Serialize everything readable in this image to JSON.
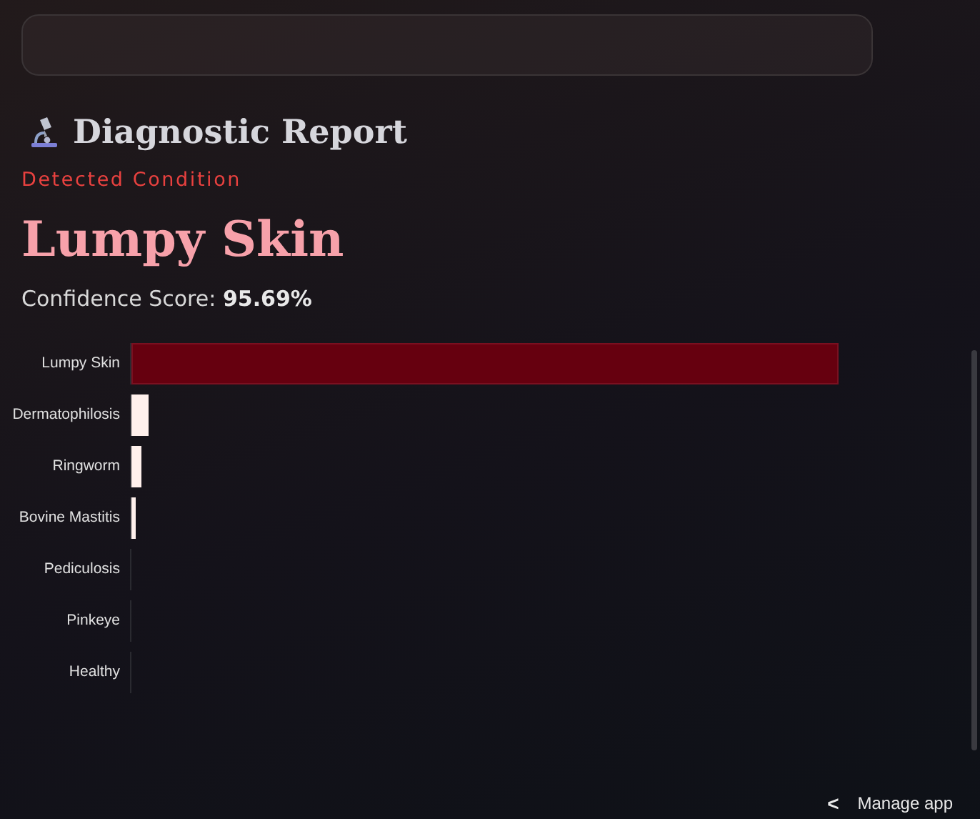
{
  "report": {
    "title": "Diagnostic Report",
    "label": "Detected Condition",
    "condition": "Lumpy Skin",
    "confidence_label": "Confidence Score:",
    "confidence_value": "95.69%"
  },
  "bars": [
    {
      "label": "Lumpy Skin",
      "level": 0.957,
      "selected": true
    },
    {
      "label": "Dermatophilosis",
      "level": 0.024,
      "selected": false
    },
    {
      "label": "Ringworm",
      "level": 0.014,
      "selected": false
    },
    {
      "label": "Bovine Mastitis",
      "level": 0.005,
      "selected": false
    },
    {
      "label": "Pediculosis",
      "level": 0,
      "selected": false
    },
    {
      "label": "Pinkeye",
      "level": 0,
      "selected": false
    },
    {
      "label": "Healthy",
      "level": 0,
      "selected": false
    }
  ],
  "footer": {
    "chevron": "<",
    "manage": "Manage app"
  }
}
